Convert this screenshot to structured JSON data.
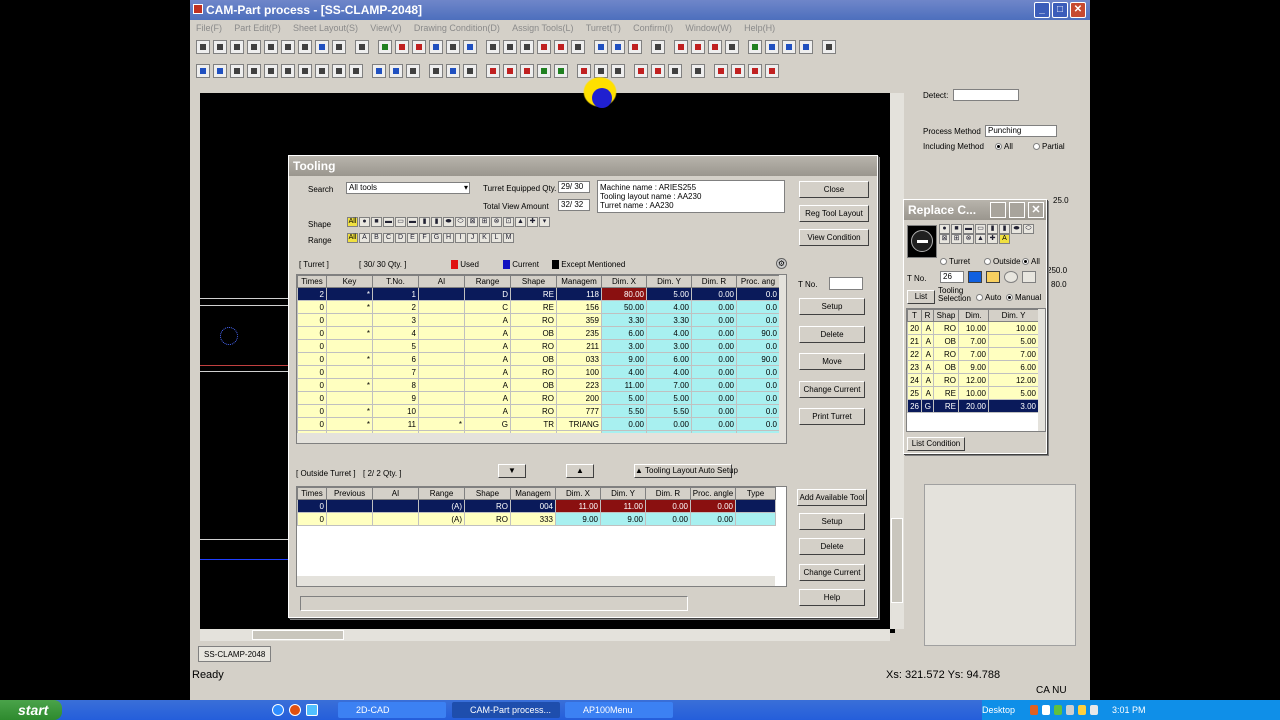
{
  "app": {
    "title": "CAM-Part process - [SS-CLAMP-2048]",
    "menu": [
      "File(F)",
      "Part Edit(P)",
      "Sheet Layout(S)",
      "View(V)",
      "Drawing Condition(D)",
      "Assign Tools(L)",
      "Turret(T)",
      "Confirm(I)",
      "Window(W)",
      "Help(H)"
    ],
    "sheet_tab": "SS-CLAMP-2048",
    "status": "Ready",
    "coords": "Xs: 321.572 Ys: 94.788",
    "caps": "CA NU"
  },
  "right_panel": {
    "detect_label": "Detect:",
    "process_method_label": "Process Method",
    "process_method_value": "Punching",
    "including_method_label": "Including Method",
    "opt_all": "All",
    "opt_partial": "Partial",
    "numbers": [
      "25.0",
      "250.0",
      "80.0"
    ]
  },
  "tooling": {
    "title": "Tooling",
    "search_label": "Search",
    "search_value": "All tools",
    "turret_qty_label": "Turret Equipped Qty.",
    "turret_qty": "29/ 30",
    "total_view_label": "Total View Amount",
    "total_view": "32/ 32",
    "machine_info": [
      "Machine name : ARIES255",
      "Tooling layout name : AA230",
      "Turret name : AA230"
    ],
    "shape_label": "Shape",
    "range_label": "Range",
    "range_chips": [
      "All",
      "A",
      "B",
      "C",
      "D",
      "E",
      "F",
      "G",
      "H",
      "I",
      "J",
      "K",
      "L",
      "M"
    ],
    "turret_label": "[ Turret ]",
    "turret_count": "[ 30/ 30 Qty. ]",
    "legend_used": "Used",
    "legend_current": "Current",
    "legend_except": "Except Mentioned",
    "turret_columns": [
      "Times",
      "Key",
      "T.No.",
      "AI",
      "Range",
      "Shape",
      "Managem",
      "Dim. X",
      "Dim. Y",
      "Dim. R",
      "Proc. ang"
    ],
    "turret_rows": [
      [
        "2",
        "*",
        "1",
        "",
        "D",
        "RE",
        "118",
        "80.00",
        "5.00",
        "0.00",
        "0.0"
      ],
      [
        "0",
        "*",
        "2",
        "",
        "C",
        "RE",
        "156",
        "50.00",
        "4.00",
        "0.00",
        "0.0"
      ],
      [
        "0",
        "",
        "3",
        "",
        "A",
        "RO",
        "359",
        "3.30",
        "3.30",
        "0.00",
        "0.0"
      ],
      [
        "0",
        "*",
        "4",
        "",
        "A",
        "OB",
        "235",
        "6.00",
        "4.00",
        "0.00",
        "90.0"
      ],
      [
        "0",
        "",
        "5",
        "",
        "A",
        "RO",
        "211",
        "3.00",
        "3.00",
        "0.00",
        "0.0"
      ],
      [
        "0",
        "*",
        "6",
        "",
        "A",
        "OB",
        "033",
        "9.00",
        "6.00",
        "0.00",
        "90.0"
      ],
      [
        "0",
        "",
        "7",
        "",
        "A",
        "RO",
        "100",
        "4.00",
        "4.00",
        "0.00",
        "0.0"
      ],
      [
        "0",
        "*",
        "8",
        "",
        "A",
        "OB",
        "223",
        "11.00",
        "7.00",
        "0.00",
        "0.0"
      ],
      [
        "0",
        "",
        "9",
        "",
        "A",
        "RO",
        "200",
        "5.00",
        "5.00",
        "0.00",
        "0.0"
      ],
      [
        "0",
        "*",
        "10",
        "",
        "A",
        "RO",
        "777",
        "5.50",
        "5.50",
        "0.00",
        "0.0"
      ],
      [
        "0",
        "*",
        "11",
        "*",
        "G",
        "TR",
        "TRIANG",
        "0.00",
        "0.00",
        "0.00",
        "0.0"
      ],
      [
        "0",
        "*",
        "12",
        "",
        "B",
        "DD",
        "120",
        "16.00",
        "14.00",
        "0.00",
        "90.0"
      ]
    ],
    "outside_label": "[ Outside Turret ]",
    "outside_count": "[ 2/ 2 Qty. ]",
    "auto_setup": "Tooling Layout Auto Setup",
    "outside_columns": [
      "Times",
      "Previous",
      "AI",
      "Range",
      "Shape",
      "Managem",
      "Dim. X",
      "Dim. Y",
      "Dim. R",
      "Proc. angle",
      "Type"
    ],
    "outside_rows": [
      [
        "0",
        "",
        "",
        "(A)",
        "RO",
        "004",
        "11.00",
        "11.00",
        "0.00",
        "0.00",
        ""
      ],
      [
        "0",
        "",
        "",
        "(A)",
        "RO",
        "333",
        "9.00",
        "9.00",
        "0.00",
        "0.00",
        ""
      ]
    ],
    "tno_label": "T No.",
    "buttons": {
      "close": "Close",
      "reg_layout": "Reg Tool Layout",
      "view_condition": "View Condition",
      "setup": "Setup",
      "delete": "Delete",
      "move": "Move",
      "change_current": "Change Current",
      "print_turret": "Print Turret",
      "add_available": "Add Available Tool",
      "setup2": "Setup",
      "delete2": "Delete",
      "change_current2": "Change Current",
      "help": "Help"
    }
  },
  "replace": {
    "title": "Replace C...",
    "opt_turret": "Turret",
    "opt_outside": "Outside",
    "opt_all": "All",
    "tno_label": "T No.",
    "tno_value": "26",
    "list_btn": "List",
    "tooling_selection": "Tooling Selection",
    "opt_auto": "Auto",
    "opt_manual": "Manual",
    "columns": [
      "T",
      "R",
      "Shap",
      "Dim.",
      "Dim. Y"
    ],
    "rows": [
      [
        "20",
        "A",
        "RO",
        "10.00",
        "10.00"
      ],
      [
        "21",
        "A",
        "OB",
        "7.00",
        "5.00"
      ],
      [
        "22",
        "A",
        "RO",
        "7.00",
        "7.00"
      ],
      [
        "23",
        "A",
        "OB",
        "9.00",
        "6.00"
      ],
      [
        "24",
        "A",
        "RO",
        "12.00",
        "12.00"
      ],
      [
        "25",
        "A",
        "RE",
        "10.00",
        "5.00"
      ],
      [
        "26",
        "G",
        "RE",
        "20.00",
        "3.00"
      ]
    ],
    "list_condition": "List Condition"
  },
  "taskbar": {
    "start": "start",
    "tasks": [
      "2D-CAD",
      "CAM-Part process...",
      "AP100Menu"
    ],
    "desktop": "Desktop",
    "clock": "3:01 PM"
  }
}
